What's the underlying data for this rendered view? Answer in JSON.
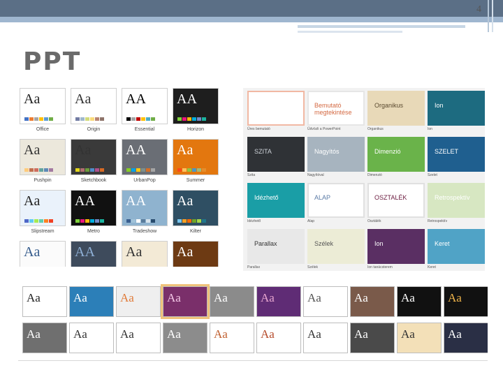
{
  "slide": {
    "number": "4",
    "title": "PPT"
  },
  "left_themes": [
    {
      "name": "Office",
      "aa": "Aa",
      "bg": "#ffffff",
      "fg": "#222222",
      "sw": [
        "#4472c4",
        "#ed7d31",
        "#a5a5a5",
        "#ffc000",
        "#5b9bd5",
        "#70ad47"
      ]
    },
    {
      "name": "Origin",
      "aa": "Aa",
      "bg": "#ffffff",
      "fg": "#333333",
      "sw": [
        "#727ca3",
        "#9fb8cd",
        "#d2da7a",
        "#fada7a",
        "#b88472",
        "#8e736a"
      ]
    },
    {
      "name": "Essential",
      "aa": "AA",
      "bg": "#ffffff",
      "fg": "#000000",
      "sw": [
        "#000000",
        "#a5a5a5",
        "#c00000",
        "#ffc000",
        "#4bacc6",
        "#70ad47"
      ]
    },
    {
      "name": "Horizon",
      "aa": "AA",
      "bg": "#1e1e1e",
      "fg": "#ffffff",
      "sw": [
        "#7fd13b",
        "#ea157a",
        "#feb80a",
        "#00addc",
        "#738ac8",
        "#1ab39f"
      ]
    },
    {
      "name": "Pushpin",
      "aa": "Aa",
      "bg": "#ece8dc",
      "fg": "#333333",
      "sw": [
        "#fdcb7c",
        "#c26e4e",
        "#ce6d5e",
        "#62a39f",
        "#5f8ab6",
        "#a37aa0"
      ]
    },
    {
      "name": "Sketchbook",
      "aa": "Aa",
      "bg": "#3a3a3a",
      "fg": "#333333",
      "sw": [
        "#e4d81c",
        "#b26e70",
        "#6b9c3b",
        "#4f8cc9",
        "#ae4f8c",
        "#d86a25"
      ]
    },
    {
      "name": "UrbanPop",
      "aa": "AA",
      "bg": "#6a6e75",
      "fg": "#ffffff",
      "sw": [
        "#86ce24",
        "#00a2e6",
        "#fac810",
        "#7d8f8c",
        "#d36f26",
        "#a5a5a5"
      ]
    },
    {
      "name": "Summer",
      "aa": "Aa",
      "bg": "#e3770f",
      "fg": "#ffffff",
      "sw": [
        "#fb4a18",
        "#fdc15e",
        "#8ec641",
        "#4e97c2",
        "#9dba7b",
        "#e58d2d"
      ]
    },
    {
      "name": "Slipstream",
      "aa": "Aa",
      "bg": "#eaf2fb",
      "fg": "#222222",
      "sw": [
        "#4e67c8",
        "#5eccf3",
        "#a7ea52",
        "#5dceaf",
        "#ff8021",
        "#f14124"
      ]
    },
    {
      "name": "Metro",
      "aa": "AA",
      "bg": "#111111",
      "fg": "#ffffff",
      "sw": [
        "#7fd13b",
        "#ea157a",
        "#feb80a",
        "#00addc",
        "#738ac8",
        "#1ab39f"
      ]
    },
    {
      "name": "Tradeshow",
      "aa": "AA",
      "bg": "#8fb3cf",
      "fg": "#ffffff",
      "sw": [
        "#3a5f8f",
        "#a0c2d9",
        "#ffffff",
        "#5a7c9c",
        "#d6e3ec",
        "#284b6d"
      ]
    },
    {
      "name": "Kilter",
      "aa": "Aa",
      "bg": "#2f4f63",
      "fg": "#ffffff",
      "sw": [
        "#76c5ef",
        "#fea022",
        "#ff6700",
        "#70a525",
        "#a5d848",
        "#20768c"
      ]
    },
    {
      "name": "",
      "aa": "Aa",
      "bg": "#fbfbfb",
      "fg": "#345b8c",
      "sw": []
    },
    {
      "name": "",
      "aa": "AA",
      "bg": "#3e4b5c",
      "fg": "#8fb0d6",
      "sw": []
    },
    {
      "name": "",
      "aa": "Aa",
      "bg": "#f3ead6",
      "fg": "#333333",
      "sw": []
    },
    {
      "name": "",
      "aa": "Aa",
      "bg": "#6d3a13",
      "fg": "#ffffff",
      "sw": []
    }
  ],
  "right_themes": [
    {
      "name": "Üres bemutató",
      "text": "",
      "bg": "#ffffff",
      "border": "#f1b8a3",
      "tc": "#333333"
    },
    {
      "name": "Üdvözli a PowerPoint",
      "text": "Bemutató megtekintése",
      "bg": "#ffffff",
      "border": "#e6e6e6",
      "tc": "#d46a43"
    },
    {
      "name": "Organikus",
      "text": "Organikus",
      "bg": "#e8d9b8",
      "border": "#e8d9b8",
      "tc": "#5a4a30"
    },
    {
      "name": "Ion",
      "text": "Ion",
      "bg": "#1d6b80",
      "border": "#1d6b80",
      "tc": "#ffffff"
    },
    {
      "name": "Szita",
      "text": "SZITA",
      "bg": "#2f3236",
      "border": "#2f3236",
      "tc": "#cfd4da"
    },
    {
      "name": "Nagyítóval",
      "text": "Nagyítós",
      "bg": "#a7b4bf",
      "border": "#a7b4bf",
      "tc": "#ffffff"
    },
    {
      "name": "Dimenzió",
      "text": "Dimenzió",
      "bg": "#6ab34a",
      "border": "#6ab34a",
      "tc": "#ffffff"
    },
    {
      "name": "Szelet",
      "text": "SZELET",
      "bg": "#1f5f8f",
      "border": "#1f5f8f",
      "tc": "#ffffff"
    },
    {
      "name": "Idézhető",
      "text": "Idézhető",
      "bg": "#1a9ea6",
      "border": "#1a9ea6",
      "tc": "#ffffff"
    },
    {
      "name": "Alap",
      "text": "ALAP",
      "bg": "#ffffff",
      "border": "#e0e0e0",
      "tc": "#5a7aa6"
    },
    {
      "name": "Osztálék",
      "text": "OSZTALÉK",
      "bg": "#ffffff",
      "border": "#e0e0e0",
      "tc": "#6b1b3f"
    },
    {
      "name": "Retrospektív",
      "text": "Retrospektív",
      "bg": "#d7e7c2",
      "border": "#d7e7c2",
      "tc": "#ffffff"
    },
    {
      "name": "Parallax",
      "text": "Parallax",
      "bg": "#e8e8e8",
      "border": "#e8e8e8",
      "tc": "#333333"
    },
    {
      "name": "Szélek",
      "text": "Szélek",
      "bg": "#ececd6",
      "border": "#ececd6",
      "tc": "#555555"
    },
    {
      "name": "Ion tanácsterem",
      "text": "Ion",
      "bg": "#5a2f63",
      "border": "#5a2f63",
      "tc": "#ffffff"
    },
    {
      "name": "Keret",
      "text": "Keret",
      "bg": "#50a3c6",
      "border": "#50a3c6",
      "tc": "#ffffff"
    }
  ],
  "bottom_themes": [
    {
      "aa": "Aa",
      "bg": "#ffffff",
      "fg": "#222222"
    },
    {
      "aa": "Aa",
      "bg": "#2c7fb8",
      "fg": "#ffffff"
    },
    {
      "aa": "Aa",
      "bg": "#efefef",
      "fg": "#e07b39"
    },
    {
      "aa": "Aa",
      "bg": "#7a2f6a",
      "fg": "#f3c6e6"
    },
    {
      "aa": "Aa",
      "bg": "#8b8b8b",
      "fg": "#ffffff"
    },
    {
      "aa": "Aa",
      "bg": "#5f2c75",
      "fg": "#e7a6cf"
    },
    {
      "aa": "Aa",
      "bg": "#ffffff",
      "fg": "#555555"
    },
    {
      "aa": "Aa",
      "bg": "#7a5a4a",
      "fg": "#ffffff"
    },
    {
      "aa": "Aa",
      "bg": "#111111",
      "fg": "#ffffff"
    },
    {
      "aa": "Aa",
      "bg": "#111111",
      "fg": "#f0b44a"
    },
    {
      "aa": "Aa",
      "bg": "#6f6f6f",
      "fg": "#ffffff"
    },
    {
      "aa": "Aa",
      "bg": "#ffffff",
      "fg": "#333333"
    },
    {
      "aa": "Aa",
      "bg": "#ffffff",
      "fg": "#333333"
    },
    {
      "aa": "Aa",
      "bg": "#8c8c8c",
      "fg": "#ffffff"
    },
    {
      "aa": "Aa",
      "bg": "#ffffff",
      "fg": "#c06030"
    },
    {
      "aa": "Aa",
      "bg": "#ffffff",
      "fg": "#b54a2a"
    },
    {
      "aa": "Aa",
      "bg": "#ffffff",
      "fg": "#333333"
    },
    {
      "aa": "Aa",
      "bg": "#4a4a4a",
      "fg": "#ffffff"
    },
    {
      "aa": "Aa",
      "bg": "#f3e0b8",
      "fg": "#333333"
    },
    {
      "aa": "Aa",
      "bg": "#2a2f45",
      "fg": "#ffffff"
    }
  ]
}
